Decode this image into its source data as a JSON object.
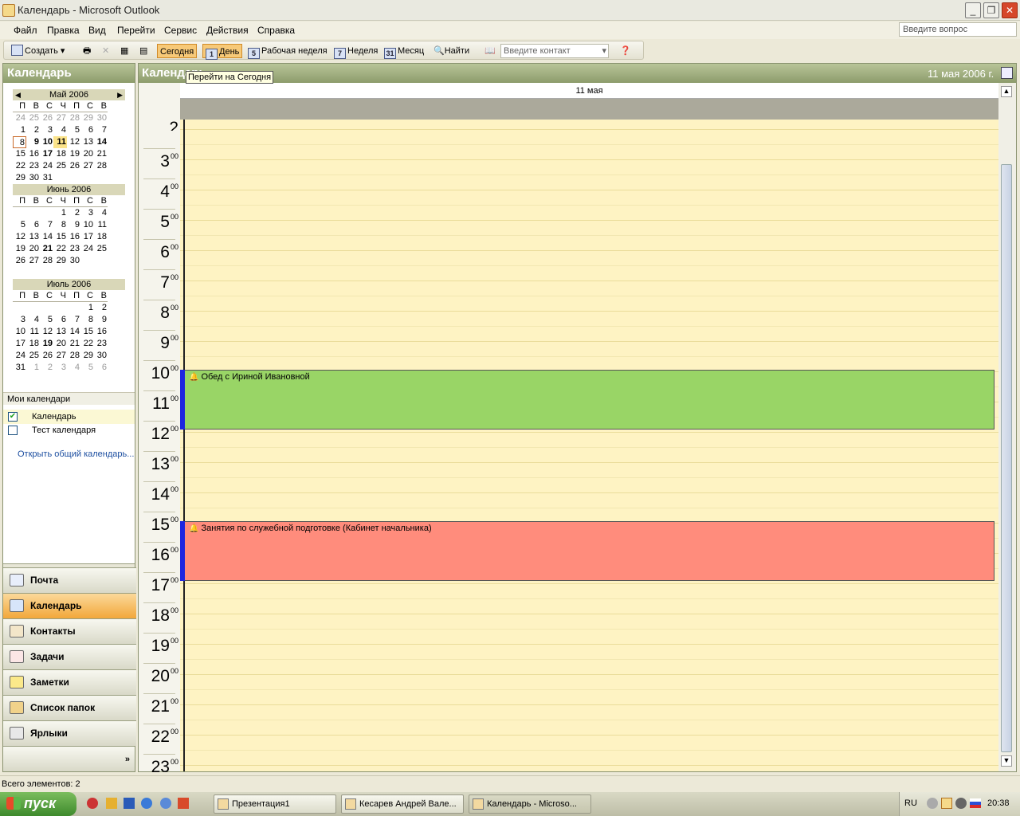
{
  "window": {
    "title": "Календарь - Microsoft Outlook"
  },
  "menu": [
    "Файл",
    "Правка",
    "Вид",
    "Перейти",
    "Сервис",
    "Действия",
    "Справка"
  ],
  "help_placeholder": "Введите вопрос",
  "toolbar": {
    "create": "Создать",
    "today": "Сегодня",
    "day": "День",
    "workweek": "Рабочая неделя",
    "week": "Неделя",
    "month": "Месяц",
    "find": "Найти",
    "contact_placeholder": "Введите контакт",
    "day_icon": "1",
    "workweek_icon": "5",
    "week_icon": "7",
    "month_icon": "31"
  },
  "tooltip": "Перейти на Сегодня",
  "navpane": {
    "title": "Календарь",
    "dow": [
      "П",
      "В",
      "С",
      "Ч",
      "П",
      "С",
      "В"
    ],
    "months": [
      {
        "title": "Май 2006",
        "weeks": [
          [
            "24",
            "25",
            "26",
            "27",
            "28",
            "29",
            "30"
          ],
          [
            "1",
            "2",
            "3",
            "4",
            "5",
            "6",
            "7"
          ],
          [
            "8",
            "9",
            "10",
            "11",
            "12",
            "13",
            "14"
          ],
          [
            "15",
            "16",
            "17",
            "18",
            "19",
            "20",
            "21"
          ],
          [
            "22",
            "23",
            "24",
            "25",
            "26",
            "27",
            "28"
          ],
          [
            "29",
            "30",
            "31",
            "",
            "",
            "",
            ""
          ]
        ]
      },
      {
        "title": "Июнь 2006",
        "weeks": [
          [
            "",
            "",
            "",
            "1",
            "2",
            "3",
            "4"
          ],
          [
            "5",
            "6",
            "7",
            "8",
            "9",
            "10",
            "11"
          ],
          [
            "12",
            "13",
            "14",
            "15",
            "16",
            "17",
            "18"
          ],
          [
            "19",
            "20",
            "21",
            "22",
            "23",
            "24",
            "25"
          ],
          [
            "26",
            "27",
            "28",
            "29",
            "30",
            "",
            ""
          ]
        ]
      },
      {
        "title": "Июль 2006",
        "weeks": [
          [
            "",
            "",
            "",
            "",
            "",
            "1",
            "2"
          ],
          [
            "3",
            "4",
            "5",
            "6",
            "7",
            "8",
            "9"
          ],
          [
            "10",
            "11",
            "12",
            "13",
            "14",
            "15",
            "16"
          ],
          [
            "17",
            "18",
            "19",
            "20",
            "21",
            "22",
            "23"
          ],
          [
            "24",
            "25",
            "26",
            "27",
            "28",
            "29",
            "30"
          ],
          [
            "31",
            "1",
            "2",
            "3",
            "4",
            "5",
            "6"
          ]
        ]
      }
    ],
    "my_calendars_title": "Мои календари",
    "calendars": [
      {
        "name": "Календарь",
        "checked": true
      },
      {
        "name": "Тест календаря",
        "checked": false
      }
    ],
    "open_shared": "Открыть общий календарь...",
    "nav_buttons": [
      "Почта",
      "Календарь",
      "Контакты",
      "Задачи",
      "Заметки",
      "Список папок",
      "Ярлыки"
    ]
  },
  "main": {
    "title": "Календарь",
    "date": "11 мая 2006 г.",
    "day_header": "11 мая",
    "hours": [
      "3",
      "4",
      "5",
      "6",
      "7",
      "8",
      "9",
      "10",
      "11",
      "12",
      "13",
      "14",
      "15",
      "16",
      "17",
      "18",
      "19",
      "20",
      "21",
      "22",
      "23"
    ],
    "minutes": "00",
    "appointments": [
      {
        "title": "Обед с Ириной Ивановной",
        "start": "11:00",
        "end": "13:00",
        "color": "#99d566"
      },
      {
        "title": "Занятия по служебной подготовке (Кабинет начальника)",
        "start": "16:00",
        "end": "18:00",
        "color": "#ff8c7c"
      }
    ]
  },
  "status": {
    "text": "Всего элементов: 2"
  },
  "taskbar": {
    "start": "пуск",
    "tasks": [
      "Презентация1",
      "Кесарев Андрей Вале...",
      "Календарь - Microso..."
    ],
    "lang": "RU",
    "clock": "20:38"
  }
}
